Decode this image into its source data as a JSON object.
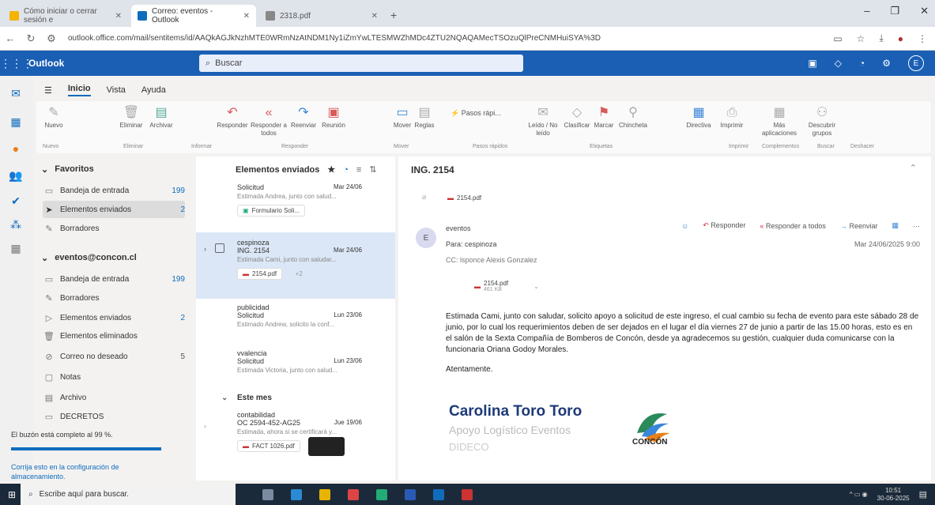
{
  "browser": {
    "tabs": [
      {
        "title": "Cómo iniciar o cerrar sesión e",
        "active": false
      },
      {
        "title": "Correo: eventos - Outlook",
        "active": true
      },
      {
        "title": "2318.pdf",
        "active": false
      }
    ],
    "url": "outlook.office.com/mail/sentitems/id/AAQkAGJkNzhMTE0WRmNzAtNDM1Ny1iZmYwLTESMWZhMDc4ZTU2NQAQAMecTSOzuQlPreCNMHuiSYA%3D"
  },
  "header": {
    "app_name": "Outlook",
    "search_placeholder": "Buscar",
    "avatar_initial": "E"
  },
  "ribbon": {
    "tabs": [
      "Inicio",
      "Vista",
      "Ayuda"
    ],
    "buttons": {
      "new": "Nuevo",
      "delete": "Eliminar",
      "archive": "Archivar",
      "reply": "Responder",
      "reply_all": "Responder a todos",
      "forward": "Reenviar",
      "meeting": "Reunión",
      "move": "Mover",
      "rules": "Reglas",
      "quick_steps": "Pasos rápi...",
      "read_unread": "Leído / No leído",
      "classify": "Clasificar",
      "mark": "Marcar",
      "pin": "Chincheta",
      "policy": "Directiva",
      "print": "Imprimir",
      "more_apps": "Más aplicaciones",
      "discover_groups": "Descubrir grupos"
    },
    "groups": {
      "new": "Nuevo",
      "delete": "Eliminar",
      "report": "Informar",
      "respond": "Responder",
      "move": "Mover",
      "quick_steps": "Pasos rápidos",
      "tags": "Etiquetas",
      "print": "Imprimir",
      "addins": "Complementos",
      "find": "Buscar",
      "undo": "Deshacer"
    }
  },
  "folders": {
    "favorites_label": "Favoritos",
    "favorites": [
      {
        "name": "Bandeja de entrada",
        "count": "199"
      },
      {
        "name": "Elementos enviados",
        "count": "2"
      },
      {
        "name": "Borradores",
        "count": ""
      }
    ],
    "account_label": "eventos@concon.cl",
    "account": [
      {
        "name": "Bandeja de entrada",
        "count": "199"
      },
      {
        "name": "Borradores",
        "count": ""
      },
      {
        "name": "Elementos enviados",
        "count": "2"
      },
      {
        "name": "Elementos eliminados",
        "count": ""
      },
      {
        "name": "Correo no deseado",
        "count": "5"
      },
      {
        "name": "Notas",
        "count": ""
      },
      {
        "name": "Archivo",
        "count": ""
      },
      {
        "name": "DECRETOS",
        "count": ""
      }
    ],
    "quota_text": "El buzón está completo al 99 %.",
    "quota_fraction": 0.99,
    "quota_link": "Corrija esto en la configuración de almacenamiento."
  },
  "message_list": {
    "title": "Elementos enviados",
    "messages": [
      {
        "from": "",
        "subject": "Solicitud",
        "date": "Mar 24/06",
        "preview": "Estimada Andrea, junto con salud...",
        "attachment": "Formulario Soli..."
      },
      {
        "from": "cespinoza",
        "subject": "ING. 2154",
        "date": "Mar 24/06",
        "preview": "Estimada Cami, junto con saludar...",
        "attachment": "2154.pdf",
        "extra": "+2"
      },
      {
        "from": "publicidad",
        "subject": "Solicitud",
        "date": "Lun 23/06",
        "preview": "Estimado Andrew, solicito la conf...",
        "attachment": ""
      },
      {
        "from": "vvalencia",
        "subject": "Solicitud",
        "date": "Lun 23/06",
        "preview": "Estimada Victoria, junto con salud...",
        "attachment": ""
      },
      {
        "from": "contabilidad",
        "subject": "OC 2594-452-AG25",
        "date": "Jue 19/06",
        "preview": "Estimada, ahora si se certificará y...",
        "attachment": "FACT 1026.pdf"
      }
    ],
    "section_this_month": "Este mes"
  },
  "reading": {
    "subject": "ING. 2154",
    "top_attachment": "2154.pdf",
    "sender": "eventos",
    "sender_initial": "E",
    "to": "Para: cespinoza",
    "cc": "CC: lsponce  Alexis Gonzalez",
    "date": "Mar 24/06/2025 9:00",
    "attachment": {
      "name": "2154.pdf",
      "size": "461 KB"
    },
    "actions": {
      "reply": "Responder",
      "reply_all": "Responder a todos",
      "forward": "Reenviar"
    },
    "body": "Estimada Cami, junto con saludar, solicito apoyo a solicitud de este ingreso, el cual cambio su fecha de evento para este sábado 28 de junio, por lo cual los requerimientos deben de ser dejados en el lugar el día viernes 27 de junio a partir de las 15.00 horas, esto es en el salón de la Sexta Compañía de Bomberos de Concón, desde ya agradecemos su gestión, cualquier duda comunicarse con la funcionaria Oriana Godoy Morales.",
    "closing": "Atentamente.",
    "signature": {
      "name": "Carolina Toro Toro",
      "role": "Apoyo Logístico Eventos",
      "dept": "DIDECO",
      "logo_text": "CONCÓN"
    }
  },
  "taskbar": {
    "search_placeholder": "Escribe aquí para buscar.",
    "time": "10:51",
    "date": "30-06-2025"
  },
  "colors": {
    "accent": "#0f6cbd",
    "header": "#1a5fb4",
    "signature": "#1e3a78"
  }
}
